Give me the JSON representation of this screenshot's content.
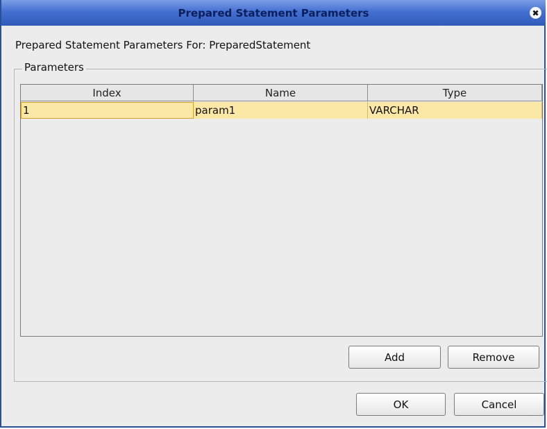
{
  "dialog": {
    "title": "Prepared Statement Parameters",
    "subtitle": "Prepared Statement Parameters For: PreparedStatement"
  },
  "parameters": {
    "group_label": "Parameters",
    "columns": [
      "Index",
      "Name",
      "Type"
    ],
    "rows": [
      {
        "index": "1",
        "name": "param1",
        "type": "VARCHAR"
      }
    ],
    "add_label": "Add",
    "remove_label": "Remove"
  },
  "footer": {
    "ok_label": "OK",
    "cancel_label": "Cancel"
  },
  "icons": {
    "close": "close-icon",
    "close_glyph": "✖"
  },
  "colors": {
    "titlebar": "#4470d2",
    "title_text": "#0a1f5c",
    "selected_row": "#fce8a6",
    "dialog_bg": "#ececec"
  }
}
